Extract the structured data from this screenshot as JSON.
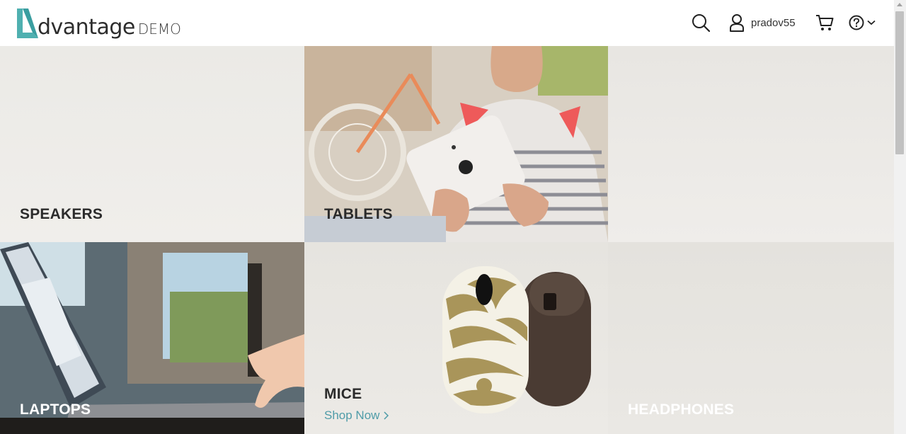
{
  "header": {
    "logo_word": "dvantage",
    "logo_demo": "DEMO",
    "username": "pradov55",
    "accent_color": "#4fb0b0",
    "icons": [
      "search-icon",
      "user-icon",
      "cart-icon",
      "help-icon",
      "chevron-down-icon"
    ]
  },
  "tiles": {
    "speakers": {
      "label": "SPEAKERS"
    },
    "tablets": {
      "label": "TABLETS"
    },
    "laptops": {
      "label": "LAPTOPS"
    },
    "mice": {
      "label": "MICE",
      "link": "Shop Now"
    },
    "headphones": {
      "label": "HEADPHONES"
    }
  }
}
